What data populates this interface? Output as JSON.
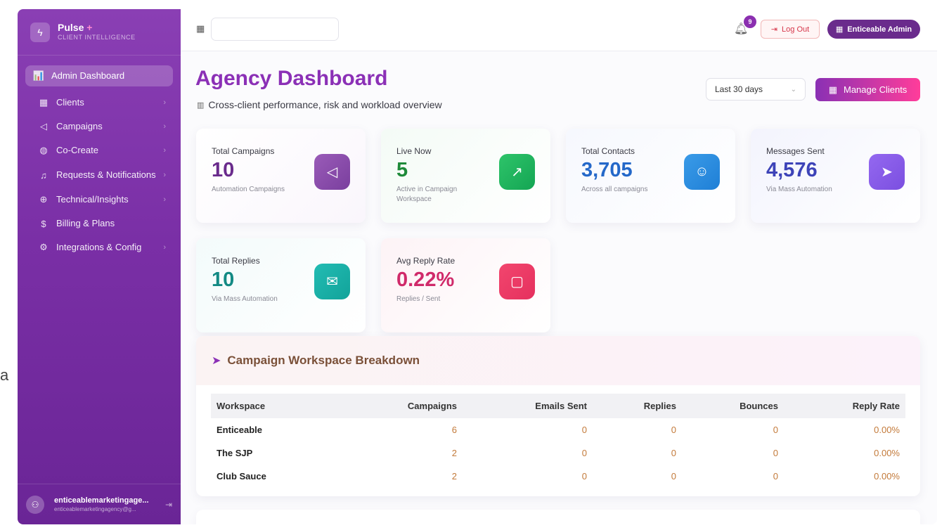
{
  "stray_text": "a",
  "brand": {
    "name": "Pulse",
    "plus": "+",
    "subtitle": "CLIENT INTELLIGENCE"
  },
  "sidebar": {
    "items": [
      {
        "label": "Admin Dashboard",
        "icon": "bar-chart-icon",
        "glyph": "📊",
        "active": true,
        "chevron": false
      },
      {
        "label": "Clients",
        "icon": "building-icon",
        "glyph": "▦",
        "active": false,
        "chevron": true
      },
      {
        "label": "Campaigns",
        "icon": "megaphone-icon",
        "glyph": "◁",
        "active": false,
        "chevron": true
      },
      {
        "label": "Co-Create",
        "icon": "palette-icon",
        "glyph": "◍",
        "active": false,
        "chevron": true
      },
      {
        "label": "Requests & Notifications",
        "icon": "bell-icon",
        "glyph": "♫",
        "active": false,
        "chevron": true
      },
      {
        "label": "Technical/Insights",
        "icon": "brain-icon",
        "glyph": "⊕",
        "active": false,
        "chevron": true
      },
      {
        "label": "Billing & Plans",
        "icon": "dollar-icon",
        "glyph": "$",
        "active": false,
        "chevron": false
      },
      {
        "label": "Integrations & Config",
        "icon": "gear-icon",
        "glyph": "⚙",
        "active": false,
        "chevron": true
      }
    ],
    "chevron": "›"
  },
  "user": {
    "name": "enticeablemarketingage...",
    "email": "enticeablemarketingagency@g..."
  },
  "topbar": {
    "search_placeholder": "",
    "notification_count": "9",
    "logout_label": "Log Out",
    "admin_label": "Enticeable Admin"
  },
  "header": {
    "title": "Agency Dashboard",
    "subtitle": "Cross-client performance, risk and workload overview",
    "range_value": "Last 30 days",
    "manage_label": "Manage Clients"
  },
  "stats": [
    {
      "label": "Total Campaigns",
      "value": "10",
      "sub": "Automation Campaigns",
      "icon": "megaphone-icon",
      "glyph": "◁",
      "color": "#6a2b8c",
      "icon_bg": "linear-gradient(135deg,#9a5bb8,#7a3f9e)",
      "card_bg": "linear-gradient(135deg,#ffffff,#faf6fc)"
    },
    {
      "label": "Live Now",
      "value": "5",
      "sub": "Active in Campaign Workspace",
      "icon": "trending-up-icon",
      "glyph": "↗",
      "color": "#1f8a3a",
      "icon_bg": "linear-gradient(135deg,#2ec46a,#14a553)",
      "card_bg": "linear-gradient(135deg,#f4fbf6,#ffffff)"
    },
    {
      "label": "Total Contacts",
      "value": "3,705",
      "sub": "Across all campaigns",
      "icon": "users-icon",
      "glyph": "☺",
      "color": "#2468c9",
      "icon_bg": "linear-gradient(135deg,#3a9be8,#1f7fd6)",
      "card_bg": "linear-gradient(135deg,#f6f8fe,#ffffff)"
    },
    {
      "label": "Messages Sent",
      "value": "4,576",
      "sub": "Via Mass Automation",
      "icon": "send-icon",
      "glyph": "➤",
      "color": "#3d43b8",
      "icon_bg": "linear-gradient(135deg,#9468f0,#7b4fe0)",
      "card_bg": "linear-gradient(135deg,#f3f4fd,#ffffff)"
    },
    {
      "label": "Total Replies",
      "value": "10",
      "sub": "Via Mass Automation",
      "icon": "mail-icon",
      "glyph": "✉",
      "color": "#138a84",
      "icon_bg": "linear-gradient(135deg,#22bcb3,#12a39a)",
      "card_bg": "linear-gradient(135deg,#f3fbfb,#ffffff)"
    },
    {
      "label": "Avg Reply Rate",
      "value": "0.22%",
      "sub": "Replies / Sent",
      "icon": "chat-icon",
      "glyph": "▢",
      "color": "#d02a6a",
      "icon_bg": "linear-gradient(135deg,#f2466e,#e5305e)",
      "card_bg": "linear-gradient(135deg,#fdf3f6,#ffffff)"
    }
  ],
  "table": {
    "title": "Campaign Workspace Breakdown",
    "columns": [
      "Workspace",
      "Campaigns",
      "Emails Sent",
      "Replies",
      "Bounces",
      "Reply Rate"
    ],
    "rows": [
      [
        "Enticeable",
        "6",
        "0",
        "0",
        "0",
        "0.00%"
      ],
      [
        "The SJP",
        "2",
        "0",
        "0",
        "0",
        "0.00%"
      ],
      [
        "Club Sauce",
        "2",
        "0",
        "0",
        "0",
        "0.00%"
      ]
    ]
  }
}
